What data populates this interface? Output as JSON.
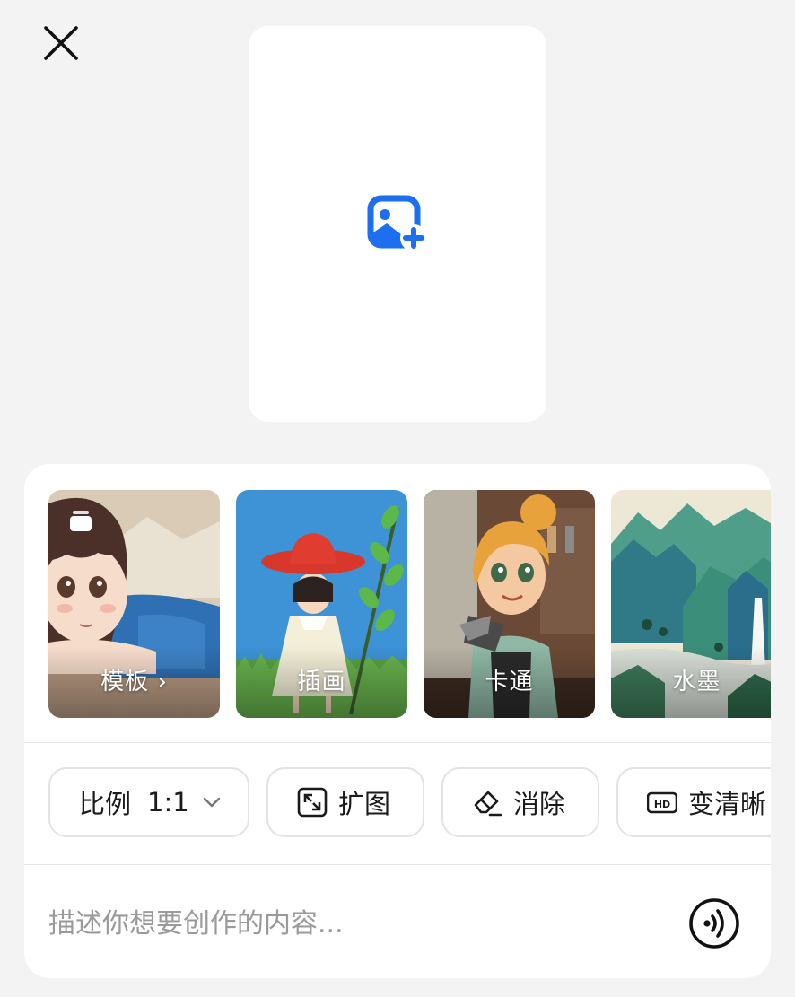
{
  "header": {
    "close_icon": "close-icon"
  },
  "upload": {
    "icon": "add-image-icon",
    "accent": "#1e6ef0"
  },
  "styles": {
    "items": [
      {
        "label": "模板",
        "chevron": "›",
        "icon": "template-stack-icon"
      },
      {
        "label": "插画"
      },
      {
        "label": "卡通"
      },
      {
        "label": "水墨"
      }
    ]
  },
  "tools": {
    "ratio_label": "比例",
    "ratio_value": "1:1",
    "expand_label": "扩图",
    "erase_label": "消除",
    "enhance_label": "变清晰",
    "enhance_badge": "HD"
  },
  "prompt": {
    "placeholder": "描述你想要创作的内容...",
    "voice_icon": "voice-icon"
  }
}
